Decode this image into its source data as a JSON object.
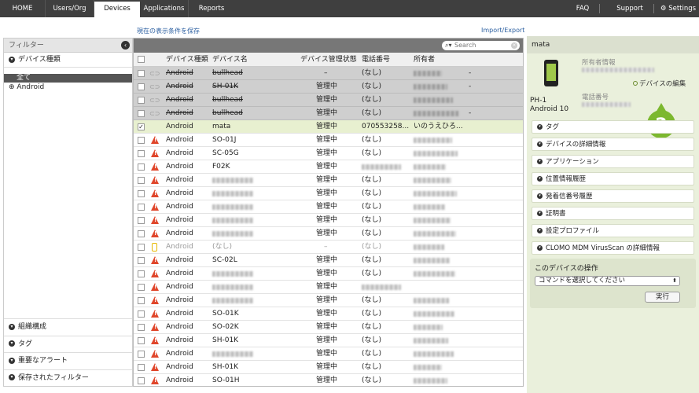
{
  "nav": {
    "home": "HOME",
    "users": "Users/Org",
    "devices": "Devices",
    "applications": "Applications",
    "reports": "Reports",
    "faq": "FAQ",
    "support": "Support",
    "settings": "Settings"
  },
  "toolbar": {
    "save_view": "現在の表示条件を保存",
    "import_export": "Import/Export",
    "search_placeholder": "Search"
  },
  "filter": {
    "title": "フィルター",
    "device_type": "デバイス種類",
    "all": "全て",
    "android": "Android",
    "org": "組織構成",
    "tag": "タグ",
    "alerts": "重要なアラート",
    "saved": "保存されたフィルター"
  },
  "columns": {
    "type": "デバイス種類",
    "name": "デバイス名",
    "state": "デバイス管理状態",
    "phone": "電話番号",
    "owner": "所有者"
  },
  "rows": [
    {
      "type": "Android",
      "name": "bullhead",
      "state": "–",
      "phone": "(なし)",
      "owner": "",
      "extra": "-",
      "style": "gray"
    },
    {
      "type": "Android",
      "name": "SH-01K",
      "state": "管理中",
      "phone": "(なし)",
      "owner": "",
      "extra": "-",
      "style": "gray"
    },
    {
      "type": "Android",
      "name": "bullhead",
      "state": "管理中",
      "phone": "(なし)",
      "owner": "",
      "extra": "",
      "style": "gray"
    },
    {
      "type": "Android",
      "name": "bullhead",
      "state": "管理中",
      "phone": "(なし)",
      "owner": "",
      "extra": "-",
      "style": "gray"
    },
    {
      "type": "Android",
      "name": "mata",
      "state": "管理中",
      "phone": "070553258...",
      "owner": "いのうえひろ...",
      "extra": "",
      "style": "sel"
    },
    {
      "type": "Android",
      "name": "SO-01J",
      "state": "管理中",
      "phone": "(なし)",
      "owner": "",
      "extra": "",
      "style": "warn"
    },
    {
      "type": "Android",
      "name": "SC-05G",
      "state": "管理中",
      "phone": "(なし)",
      "owner": "",
      "extra": "",
      "style": "warn"
    },
    {
      "type": "Android",
      "name": "F02K",
      "state": "管理中",
      "phone": "",
      "owner": "",
      "extra": "",
      "style": "warn"
    },
    {
      "type": "Android",
      "name": "",
      "state": "管理中",
      "phone": "(なし)",
      "owner": "",
      "extra": "",
      "style": "warn"
    },
    {
      "type": "Android",
      "name": "",
      "state": "管理中",
      "phone": "(なし)",
      "owner": "",
      "extra": "",
      "style": "warn"
    },
    {
      "type": "Android",
      "name": "",
      "state": "管理中",
      "phone": "(なし)",
      "owner": "",
      "extra": "",
      "style": "warn"
    },
    {
      "type": "Android",
      "name": "",
      "state": "管理中",
      "phone": "(なし)",
      "owner": "",
      "extra": "",
      "style": "warn"
    },
    {
      "type": "Android",
      "name": "",
      "state": "管理中",
      "phone": "(なし)",
      "owner": "",
      "extra": "",
      "style": "warn"
    },
    {
      "type": "Android",
      "name": "(なし)",
      "state": "–",
      "phone": "(なし)",
      "owner": "",
      "extra": "",
      "style": "dim"
    },
    {
      "type": "Android",
      "name": "SC-02L",
      "state": "管理中",
      "phone": "(なし)",
      "owner": "",
      "extra": "",
      "style": "warn"
    },
    {
      "type": "Android",
      "name": "",
      "state": "管理中",
      "phone": "(なし)",
      "owner": "",
      "extra": "",
      "style": "warn"
    },
    {
      "type": "Android",
      "name": "",
      "state": "管理中",
      "phone": "",
      "owner": "",
      "extra": "",
      "style": "warn"
    },
    {
      "type": "Android",
      "name": "",
      "state": "管理中",
      "phone": "(なし)",
      "owner": "",
      "extra": "",
      "style": "warn"
    },
    {
      "type": "Android",
      "name": "SO-01K",
      "state": "管理中",
      "phone": "(なし)",
      "owner": "",
      "extra": "",
      "style": "warn"
    },
    {
      "type": "Android",
      "name": "SO-02K",
      "state": "管理中",
      "phone": "(なし)",
      "owner": "",
      "extra": "",
      "style": "warn"
    },
    {
      "type": "Android",
      "name": "SH-01K",
      "state": "管理中",
      "phone": "(なし)",
      "owner": "",
      "extra": "",
      "style": "warn"
    },
    {
      "type": "Android",
      "name": "",
      "state": "管理中",
      "phone": "(なし)",
      "owner": "",
      "extra": "",
      "style": "warn"
    },
    {
      "type": "Android",
      "name": "SH-01K",
      "state": "管理中",
      "phone": "(なし)",
      "owner": "",
      "extra": "",
      "style": "warn"
    },
    {
      "type": "Android",
      "name": "SO-01H",
      "state": "管理中",
      "phone": "(なし)",
      "owner": "",
      "extra": "",
      "style": "warn"
    }
  ],
  "detail": {
    "title": "mata",
    "model": "PH-1",
    "os": "Android 10",
    "owner_label": "所有者情報",
    "edit": "デバイスの編集",
    "phone_label": "電話番号",
    "badge": "2",
    "sections": [
      "タグ",
      "デバイスの詳細情報",
      "アプリケーション",
      "位置情報履歴",
      "発着信番号履歴",
      "証明書",
      "設定プロファイル",
      "CLOMO MDM VirusScan の詳細情報"
    ],
    "ops_title": "このデバイスの操作",
    "command_placeholder": "コマンドを選択してください",
    "run": "実行"
  },
  "colors": {
    "accent_green": "#7cb82f",
    "warn_red": "#e0462b",
    "link_blue": "#2a5ea0"
  }
}
